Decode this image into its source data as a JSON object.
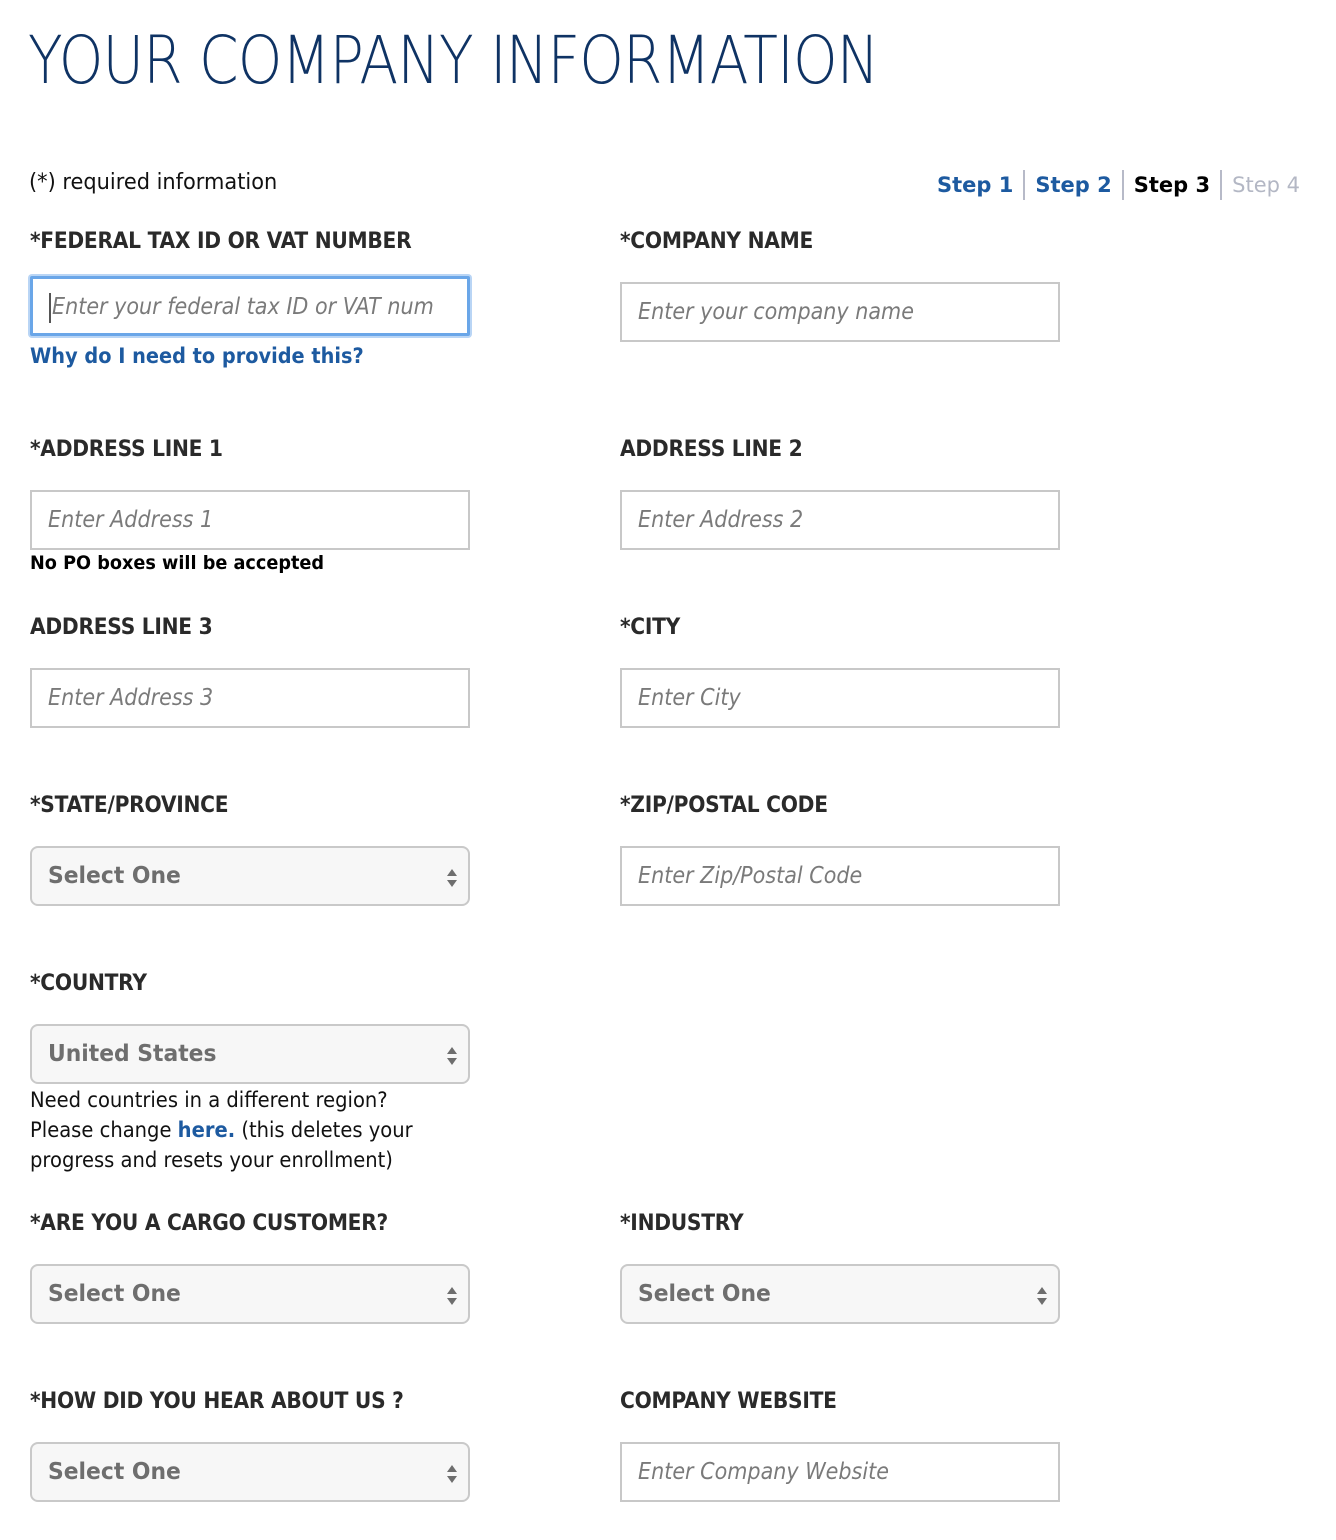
{
  "page": {
    "title": "YOUR COMPANY INFORMATION",
    "required_note": "(*) required information"
  },
  "steps": [
    {
      "label": "Step 1",
      "state": "done"
    },
    {
      "label": "Step 2",
      "state": "done"
    },
    {
      "label": "Step 3",
      "state": "current"
    },
    {
      "label": "Step 4",
      "state": "future"
    }
  ],
  "colors": {
    "title": "#0f3364",
    "link": "#1d5aa0",
    "focus_ring": "#6aa6e8",
    "step_future": "#b3b7c4"
  },
  "fields": {
    "tax_id": {
      "label": "*FEDERAL TAX ID OR VAT NUMBER",
      "placeholder": "Enter your federal tax ID or VAT num",
      "value": "",
      "help_link": "Why do I need to provide this?",
      "focused": true
    },
    "company_name": {
      "label": "*COMPANY NAME",
      "placeholder": "Enter your company name",
      "value": ""
    },
    "address1": {
      "label": "*ADDRESS LINE 1",
      "placeholder": "Enter Address 1",
      "value": "",
      "note": "No PO boxes will be accepted"
    },
    "address2": {
      "label": "ADDRESS LINE 2",
      "placeholder": "Enter Address 2",
      "value": ""
    },
    "address3": {
      "label": "ADDRESS LINE 3",
      "placeholder": "Enter Address 3",
      "value": ""
    },
    "city": {
      "label": "*CITY",
      "placeholder": "Enter City",
      "value": ""
    },
    "state": {
      "label": "*STATE/PROVINCE",
      "selected": "Select One"
    },
    "zip": {
      "label": "*ZIP/POSTAL CODE",
      "placeholder": "Enter Zip/Postal Code",
      "value": ""
    },
    "country": {
      "label": "*COUNTRY",
      "selected": "United States",
      "note_line1": "Need countries in a different region?",
      "note_prefix": "Please change ",
      "note_link": "here.",
      "note_suffix": " (this deletes your progress and resets your enrollment)"
    },
    "cargo": {
      "label": "*ARE YOU A CARGO CUSTOMER?",
      "selected": "Select One"
    },
    "industry": {
      "label": "*INDUSTRY",
      "selected": "Select One"
    },
    "heard_about": {
      "label": "*HOW DID YOU HEAR ABOUT US ?",
      "selected": "Select One"
    },
    "website": {
      "label": "COMPANY WEBSITE",
      "placeholder": "Enter Company Website",
      "value": ""
    }
  }
}
